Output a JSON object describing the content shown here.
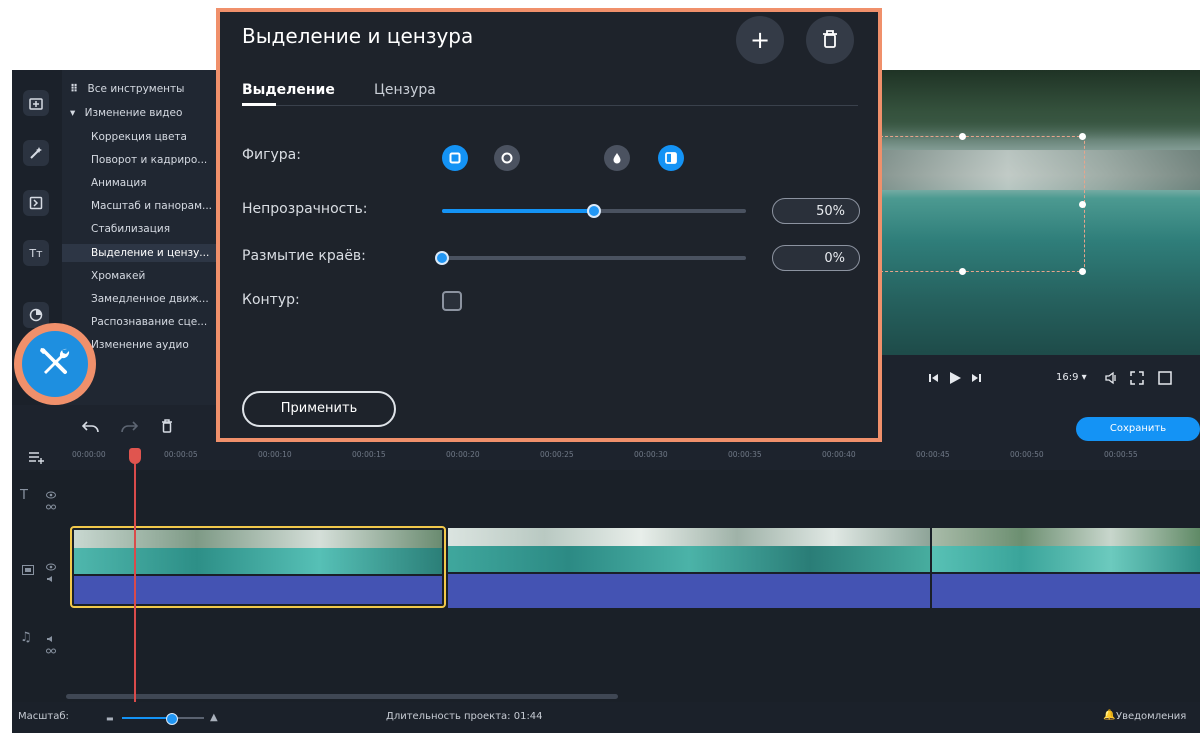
{
  "sidebar_icons": [
    "import-icon",
    "magic-icon",
    "transitions-icon",
    "titles-icon",
    "stickers-icon"
  ],
  "titles_icon_text": "Tт",
  "tools": {
    "all_label": "Все инструменты",
    "items": [
      {
        "label": "Изменение видео"
      },
      {
        "label": "Коррекция цвета"
      },
      {
        "label": "Поворот и кадриро..."
      },
      {
        "label": "Анимация"
      },
      {
        "label": "Масштаб и панорам..."
      },
      {
        "label": "Стабилизация"
      },
      {
        "label": "Выделение и цензу..."
      },
      {
        "label": "Хромакей"
      },
      {
        "label": "Замедленное движ..."
      },
      {
        "label": "Распознавание сце..."
      },
      {
        "label": "Изменение аудио"
      }
    ]
  },
  "panel": {
    "title": "Выделение и цензура",
    "tabs": [
      {
        "label": "Выделение"
      },
      {
        "label": "Цензура"
      }
    ],
    "shape_label": "Фигура:",
    "opacity_label": "Непрозрачность:",
    "opacity_value": "50%",
    "opacity_fraction": 0.5,
    "feather_label": "Размытие краёв:",
    "feather_value": "0%",
    "feather_fraction": 0,
    "outline_label": "Контур:",
    "apply_label": "Применить"
  },
  "player": {
    "aspect_label": "16:9 ▾"
  },
  "timeline": {
    "save_label": "Сохранить",
    "ticks": [
      "00:00:00",
      "00:00:05",
      "00:00:10",
      "00:00:15",
      "00:00:20",
      "00:00:25",
      "00:00:30",
      "00:00:35",
      "00:00:40",
      "00:00:45",
      "00:00:50",
      "00:00:55"
    ]
  },
  "status": {
    "scale_label": "Масштаб:",
    "duration_label": "Длительность проекта: 01:44",
    "notifications_label": "Уведомления"
  },
  "colors": {
    "accent": "#1493f5",
    "highlight": "#f0906b",
    "clip_selected": "#f2c94c",
    "audio": "#4453b3",
    "playhead": "#d94b4b"
  }
}
